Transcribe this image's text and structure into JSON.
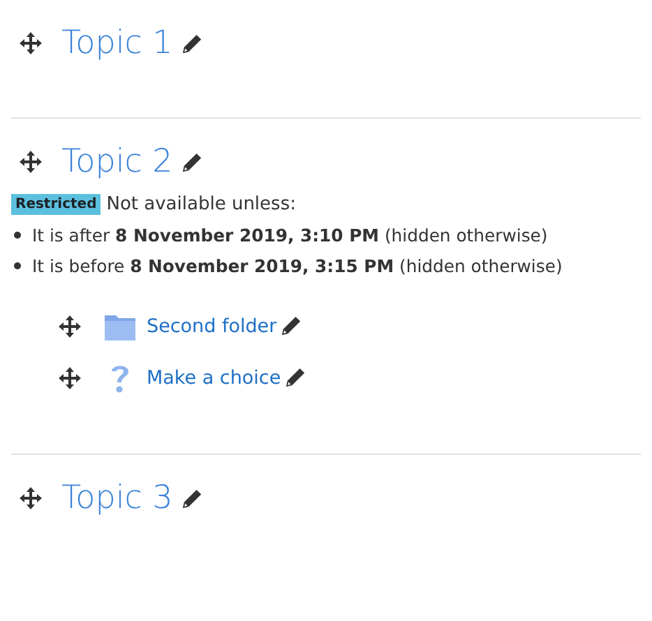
{
  "sections": [
    {
      "title": "Topic 1"
    },
    {
      "title": "Topic 2",
      "restriction": {
        "badge": "Restricted",
        "intro": "Not available unless:",
        "conditions": [
          "It is after **8 November 2019, 3:10 PM** (hidden otherwise)",
          "It is before **8 November 2019, 3:15 PM** (hidden otherwise)"
        ]
      },
      "activities": [
        {
          "kind": "folder",
          "name": "Second folder"
        },
        {
          "kind": "question",
          "name": "Make a choice"
        }
      ]
    },
    {
      "title": "Topic 3"
    }
  ]
}
